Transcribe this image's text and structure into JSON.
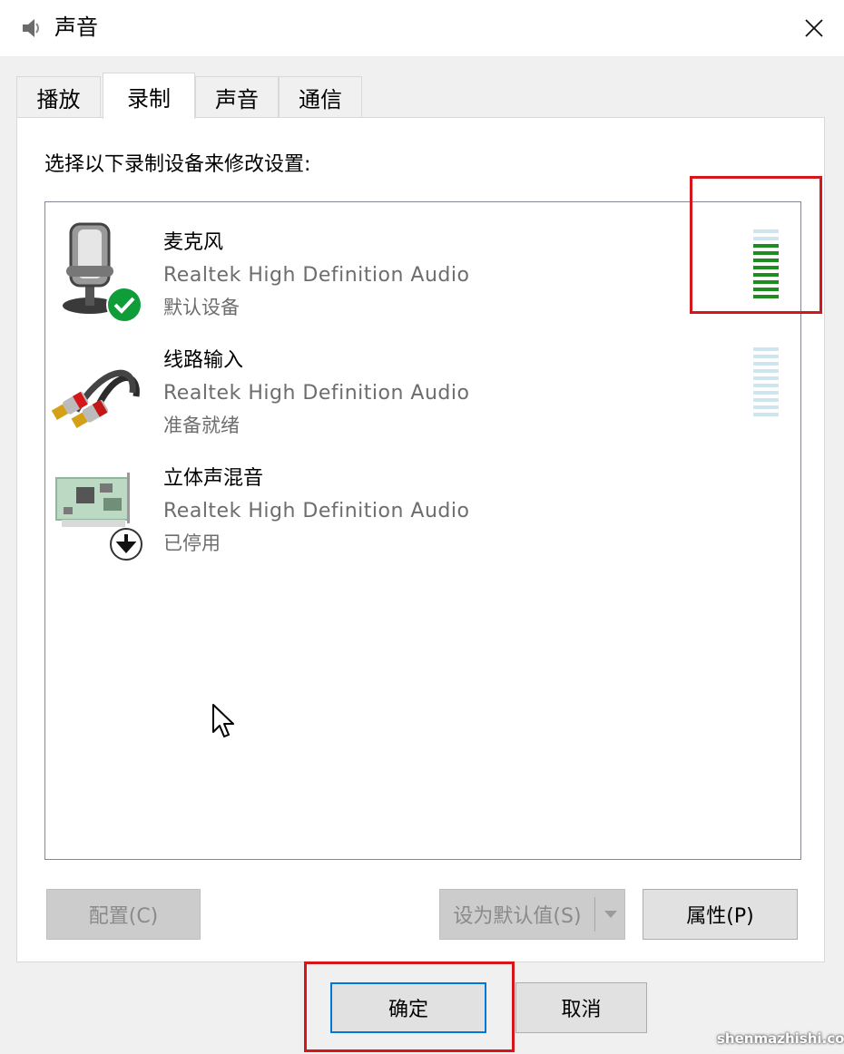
{
  "window": {
    "title": "声音",
    "icon": "speaker-icon",
    "close_icon": "close-icon"
  },
  "tabs": [
    {
      "label": "播放",
      "active": false
    },
    {
      "label": "录制",
      "active": true
    },
    {
      "label": "声音",
      "active": false
    },
    {
      "label": "通信",
      "active": false
    }
  ],
  "panel": {
    "instruction": "选择以下录制设备来修改设置:"
  },
  "devices": [
    {
      "name": "麦克风",
      "driver": "Realtek High Definition Audio",
      "status": "默认设备",
      "icon": "microphone-icon",
      "badge": "check-badge-icon",
      "level_fraction": 0.75
    },
    {
      "name": "线路输入",
      "driver": "Realtek High Definition Audio",
      "status": "准备就绪",
      "icon": "rca-cable-icon",
      "level_fraction": 0
    },
    {
      "name": "立体声混音",
      "driver": "Realtek High Definition Audio",
      "status": "已停用",
      "icon": "sound-card-icon",
      "badge": "down-arrow-badge-icon"
    }
  ],
  "buttons": {
    "configure": "配置(C)",
    "set_default": "设为默认值(S)",
    "properties": "属性(P)",
    "ok": "确定",
    "cancel": "取消"
  },
  "colors": {
    "highlight": "#d6161b",
    "meter_on": "#1e8c1e",
    "meter_off": "#cfe5ee",
    "focus": "#0078d7",
    "check_badge": "#0f9d3a"
  },
  "watermark": "shenmazhishi.com"
}
